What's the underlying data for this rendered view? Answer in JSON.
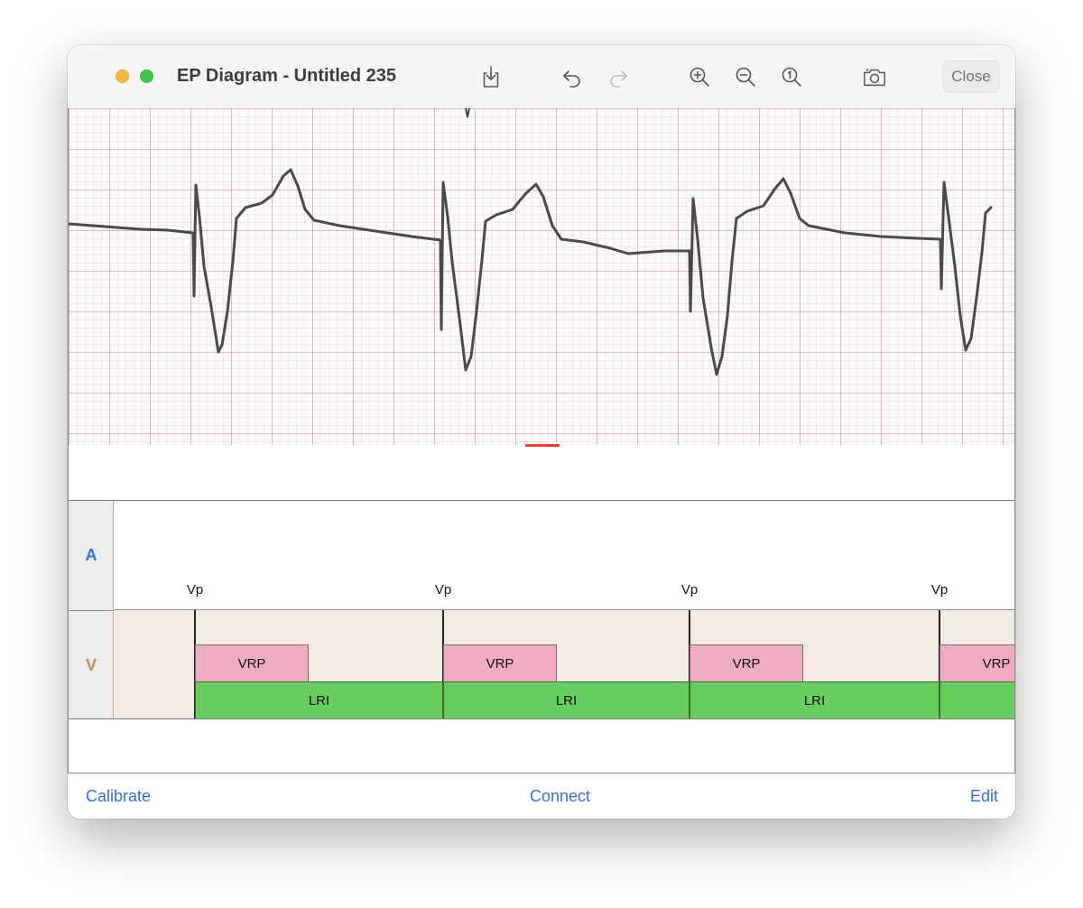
{
  "window": {
    "title": "EP Diagram - Untitled 235"
  },
  "toolbar": {
    "icons": [
      "save-icon",
      "undo-icon",
      "redo-icon",
      "zoom-in-icon",
      "zoom-out-icon",
      "zoom-reset-icon",
      "camera-icon"
    ],
    "close_label": "Close"
  },
  "ladder": {
    "rows": [
      {
        "label": "A",
        "color": "#2a6fdb"
      },
      {
        "label": "V",
        "color": "#b8925a"
      }
    ],
    "marks": [
      "Vp",
      "Vp",
      "Vp",
      "Vp"
    ],
    "vrp_label": "VRP",
    "lri_label": "LRI",
    "colors": {
      "vrp": "#f0adc1",
      "lri": "#69cc5e",
      "v_region": "#f1ebe1"
    }
  },
  "bottom": {
    "calibrate": "Calibrate",
    "connect": "Connect",
    "edit": "Edit"
  }
}
